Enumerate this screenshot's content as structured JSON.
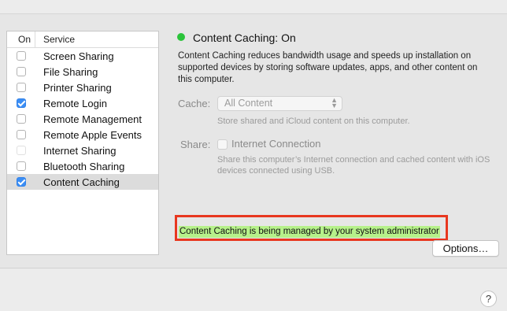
{
  "services": {
    "header_on": "On",
    "header_service": "Service",
    "items": [
      {
        "label": "Screen Sharing",
        "checked": false,
        "enabled": true
      },
      {
        "label": "File Sharing",
        "checked": false,
        "enabled": true
      },
      {
        "label": "Printer Sharing",
        "checked": false,
        "enabled": true
      },
      {
        "label": "Remote Login",
        "checked": true,
        "enabled": true
      },
      {
        "label": "Remote Management",
        "checked": false,
        "enabled": true
      },
      {
        "label": "Remote Apple Events",
        "checked": false,
        "enabled": true
      },
      {
        "label": "Internet Sharing",
        "checked": false,
        "enabled": false
      },
      {
        "label": "Bluetooth Sharing",
        "checked": false,
        "enabled": true
      },
      {
        "label": "Content Caching",
        "checked": true,
        "enabled": true,
        "selected": true
      }
    ]
  },
  "detail": {
    "status_title": "Content Caching: On",
    "status_color": "#2bc43b",
    "description": "Content Caching reduces bandwidth usage and speeds up installation on supported devices by storing software updates, apps, and other content on this computer.",
    "cache_label": "Cache:",
    "cache_value": "All Content",
    "cache_hint": "Store shared and iCloud content on this computer.",
    "share_label": "Share:",
    "share_option": "Internet Connection",
    "share_hint": "Share this computer’s Internet connection and cached content with iOS devices connected using USB.",
    "managed_notice": "Content Caching is being managed by your system administrator",
    "options_button": "Options…"
  },
  "footer": {
    "help_icon": "?"
  },
  "colors": {
    "highlight_border": "#e8371f",
    "highlight_fill": "#b6f18a",
    "checkbox_accent": "#3b8ef5"
  }
}
